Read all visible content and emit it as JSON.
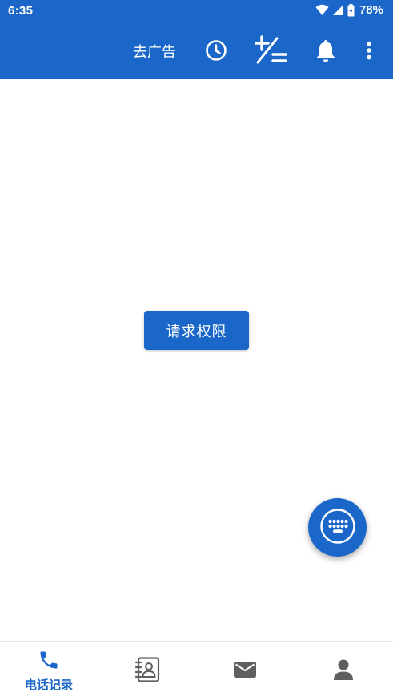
{
  "status_bar": {
    "time": "6:35",
    "battery": "78%"
  },
  "app_bar": {
    "ad_label": "去广告",
    "icons": [
      "clock-icon",
      "plus-minus-icon",
      "bell-icon",
      "more-vert-icon"
    ]
  },
  "main": {
    "permission_button": "请求权限"
  },
  "bottom_nav": {
    "items": [
      {
        "label": "电话记录",
        "icon": "phone-icon",
        "active": true
      },
      {
        "label": "",
        "icon": "contacts-book-icon",
        "active": false
      },
      {
        "label": "",
        "icon": "mail-icon",
        "active": false
      },
      {
        "label": "",
        "icon": "person-icon",
        "active": false
      }
    ]
  },
  "colors": {
    "primary": "#1a67c9",
    "inactive_icon": "#5f5f5f"
  }
}
